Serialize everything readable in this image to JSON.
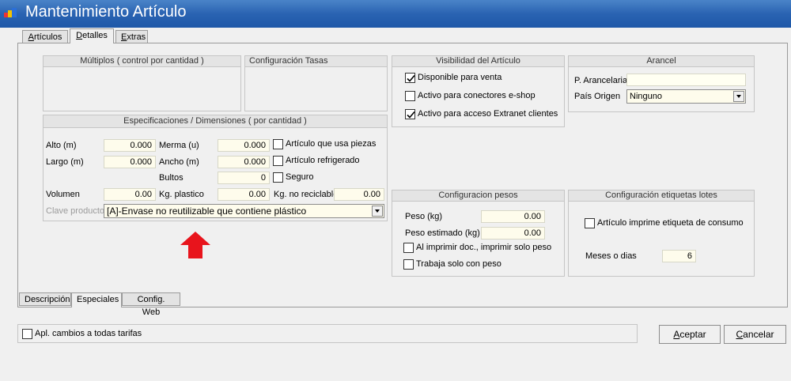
{
  "window": {
    "title": "Mantenimiento Artículo"
  },
  "top_tabs": [
    {
      "label": "Artículos",
      "accel": "A",
      "rest": "rtículos"
    },
    {
      "label": "Detalles",
      "accel": "D",
      "rest": "etalles"
    },
    {
      "label": "Extras",
      "accel": "E",
      "rest": "xtras"
    }
  ],
  "multiplos": {
    "title": "Múltiplos ( control por cantidad )"
  },
  "tasas": {
    "title": "Configuración Tasas"
  },
  "especificaciones": {
    "title": "Especificaciones / Dimensiones ( por cantidad )",
    "alto_label": "Alto (m)",
    "alto_value": "0.000",
    "largo_label": "Largo (m)",
    "largo_value": "0.000",
    "volumen_label": "Volumen",
    "volumen_value": "0.00",
    "merma_label": "Merma (u)",
    "merma_value": "0.000",
    "ancho_label": "Ancho (m)",
    "ancho_value": "0.000",
    "bultos_label": "Bultos",
    "bultos_value": "0",
    "kg_plastico_label": "Kg. plastico",
    "kg_plastico_value": "0.00",
    "kg_no_reciclable_label": "Kg. no reciclable",
    "kg_no_reciclable_value": "0.00",
    "piezas_label": "Artículo que usa piezas",
    "piezas_checked": false,
    "refrigerado_label": "Artículo refrigerado",
    "refrigerado_checked": false,
    "seguro_label": "Seguro",
    "seguro_checked": false,
    "clave_label": "Clave producto",
    "clave_value": "[A]-Envase no reutilizable que contiene plástico"
  },
  "visibilidad": {
    "title": "Visibilidad del Artículo",
    "items": [
      {
        "label": "Disponible para venta",
        "checked": true
      },
      {
        "label": "Activo para conectores e-shop",
        "checked": false
      },
      {
        "label": "Activo para acceso Extranet clientes",
        "checked": true
      }
    ]
  },
  "arancel": {
    "title": "Arancel",
    "partida_label": "P. Arancelaria",
    "partida_value": "",
    "pais_label": "País Origen",
    "pais_value": "Ninguno"
  },
  "pesos": {
    "title": "Configuracion pesos",
    "peso_label": "Peso (kg)",
    "peso_value": "0.00",
    "peso_estimado_label": "Peso estimado (kg)",
    "peso_estimado_value": "0.00",
    "imprimir_label": "Al imprimir doc., imprimir solo peso",
    "imprimir_checked": false,
    "trabaja_label": "Trabaja solo con peso",
    "trabaja_checked": false
  },
  "etiquetas": {
    "title": "Configuración etiquetas lotes",
    "imprime_label": "Artículo imprime etiqueta de consumo",
    "imprime_checked": false,
    "meses_label": "Meses o dias",
    "meses_value": "6"
  },
  "bottom_tabs": [
    {
      "label": "Descripción"
    },
    {
      "label": "Especiales"
    },
    {
      "label": "Config. Web"
    }
  ],
  "footer": {
    "apl_label": "Apl. cambios a todas tarifas",
    "apl_checked": false,
    "aceptar_accel": "A",
    "aceptar_rest": "ceptar",
    "cancelar_accel": "C",
    "cancelar_rest": "ancelar"
  },
  "colors": {
    "titlebar": "#2a63b2",
    "field_bg": "#fefcec",
    "arrow": "#e8141c"
  },
  "icons": {
    "arrow": "red-up-arrow-icon",
    "check": "checkmark-icon",
    "dropdown": "chevron-down-icon"
  }
}
